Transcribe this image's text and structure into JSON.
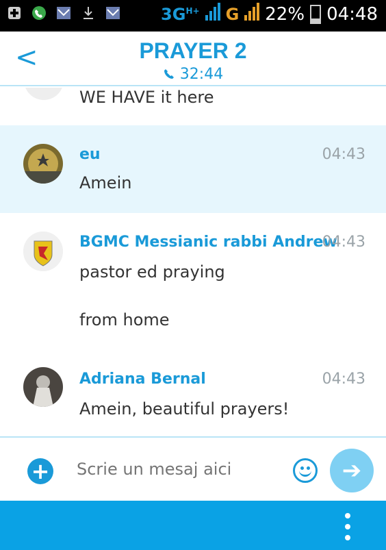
{
  "status_bar": {
    "network_text": "3G",
    "network_sub": "H+",
    "network_letter": "G",
    "battery_percent": "22%",
    "battery_level": 0.22,
    "time": "04:48"
  },
  "header": {
    "back_label": "<",
    "title": "PRAYER 2",
    "call_icon": "phone-icon",
    "call_duration": "32:44"
  },
  "messages": [
    {
      "partial": true,
      "text": "WE HAVE it here"
    },
    {
      "sender": "eu",
      "time": "04:43",
      "lines": [
        "Amein"
      ],
      "highlight": true
    },
    {
      "sender": "BGMC Messianic rabbi Andrew",
      "time": "04:43",
      "lines": [
        "pastor ed praying",
        "from home"
      ]
    },
    {
      "sender": "Adriana Bernal",
      "time": "04:43",
      "lines": [
        "Amein, beautiful prayers!"
      ]
    }
  ],
  "composer": {
    "placeholder": "Scrie un mesaj aici",
    "add_icon": "plus-icon",
    "emoji_icon": "emoji-icon",
    "send_icon": "send-arrow-icon"
  },
  "colors": {
    "accent": "#1a9ad8",
    "highlight_bg": "#e6f6fd",
    "bottom_bar": "#0aa2e5"
  }
}
